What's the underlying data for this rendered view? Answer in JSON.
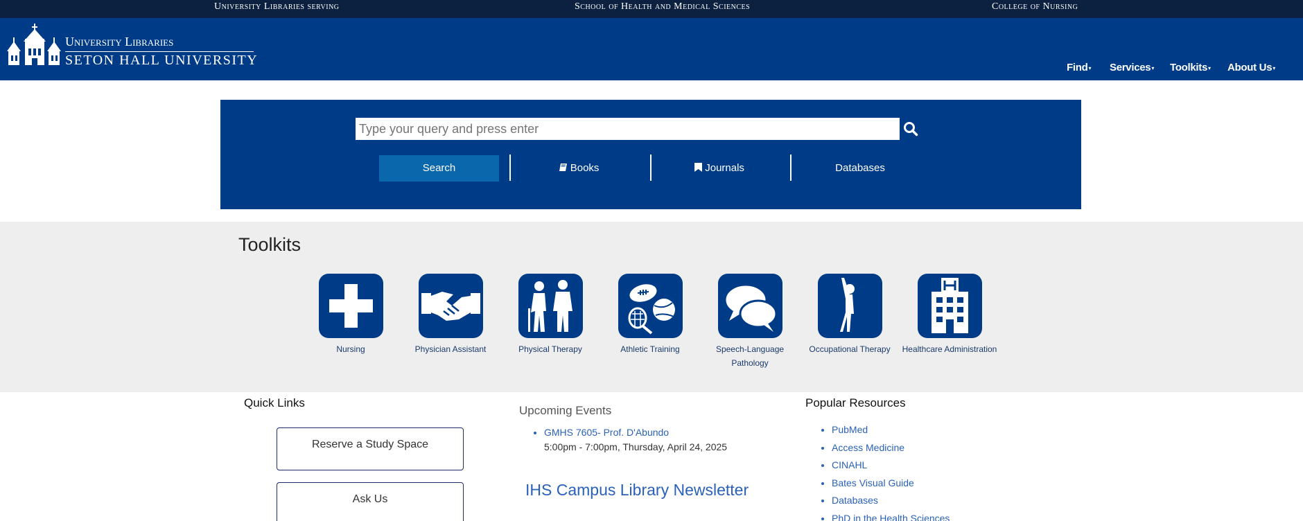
{
  "top_strip": {
    "left": "University Libraries serving",
    "center": "School of Health and Medical Sciences",
    "right": "College of Nursing"
  },
  "header": {
    "logo_line1": "University Libraries",
    "logo_line2": "SETON HALL UNIVERSITY",
    "nav": [
      {
        "label": "Find"
      },
      {
        "label": "Services"
      },
      {
        "label": "Toolkits"
      },
      {
        "label": "About Us"
      }
    ]
  },
  "search": {
    "placeholder": "Type your query and press enter",
    "tabs": [
      {
        "label": "Search",
        "icon": ""
      },
      {
        "label": "Books",
        "icon": "book-icon"
      },
      {
        "label": "Journals",
        "icon": "bookmark-icon"
      },
      {
        "label": "Databases",
        "icon": ""
      }
    ]
  },
  "toolkits": {
    "title": "Toolkits",
    "items": [
      {
        "label": "Nursing",
        "icon": "medical-cross-icon"
      },
      {
        "label": "Physician Assistant",
        "icon": "handshake-icon"
      },
      {
        "label": "Physical Therapy",
        "icon": "walking-assist-icon"
      },
      {
        "label": "Athletic Training",
        "icon": "sports-balls-icon"
      },
      {
        "label": "Speech-Language Pathology",
        "icon": "speech-bubbles-icon"
      },
      {
        "label": "Occupational Therapy",
        "icon": "stretching-person-icon"
      },
      {
        "label": "Healthcare Administration",
        "icon": "hospital-building-icon"
      }
    ]
  },
  "quick_links": {
    "title": "Quick Links",
    "buttons": [
      "Reserve a Study Space",
      "Ask Us"
    ]
  },
  "events": {
    "title": "Upcoming Events",
    "items": [
      {
        "name": "GMHS 7605- Prof. D'Abundo",
        "time": "5:00pm - 7:00pm, Thursday, April 24, 2025"
      }
    ],
    "newsletter": "IHS Campus Library Newsletter"
  },
  "popular": {
    "title": "Popular Resources",
    "items": [
      "PubMed",
      "Access Medicine",
      "CINAHL",
      "Bates Visual Guide",
      "Databases",
      "PhD in the Health Sciences"
    ]
  },
  "colors": {
    "brand_navy": "#003b87",
    "top_strip": "#0c2040",
    "active_tab": "#0a67ab",
    "link": "#2a61b9"
  }
}
